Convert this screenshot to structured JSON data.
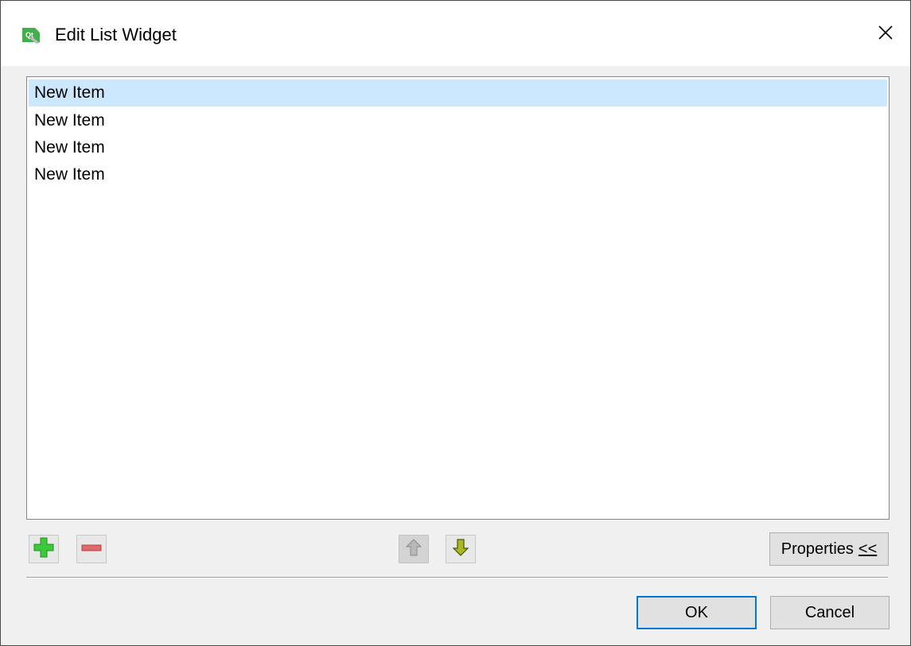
{
  "window": {
    "title": "Edit List Widget",
    "app_icon": "qt-designer-icon",
    "close_icon": "close-icon"
  },
  "list": {
    "items": [
      {
        "label": "New Item",
        "selected": true
      },
      {
        "label": "New Item",
        "selected": false
      },
      {
        "label": "New Item",
        "selected": false
      },
      {
        "label": "New Item",
        "selected": false
      }
    ]
  },
  "toolbar": {
    "add_icon": "plus-icon",
    "remove_icon": "minus-icon",
    "move_up_icon": "arrow-up-icon",
    "move_down_icon": "arrow-down-icon",
    "properties_label": "Properties",
    "properties_suffix": "<<"
  },
  "buttons": {
    "ok_label": "OK",
    "cancel_label": "Cancel"
  },
  "colors": {
    "selection": "#cce8ff",
    "default_button_border": "#0078d7",
    "add_green": "#3cc83c",
    "remove_red": "#e06a6a",
    "arrow_olive": "#8a9a1a"
  }
}
